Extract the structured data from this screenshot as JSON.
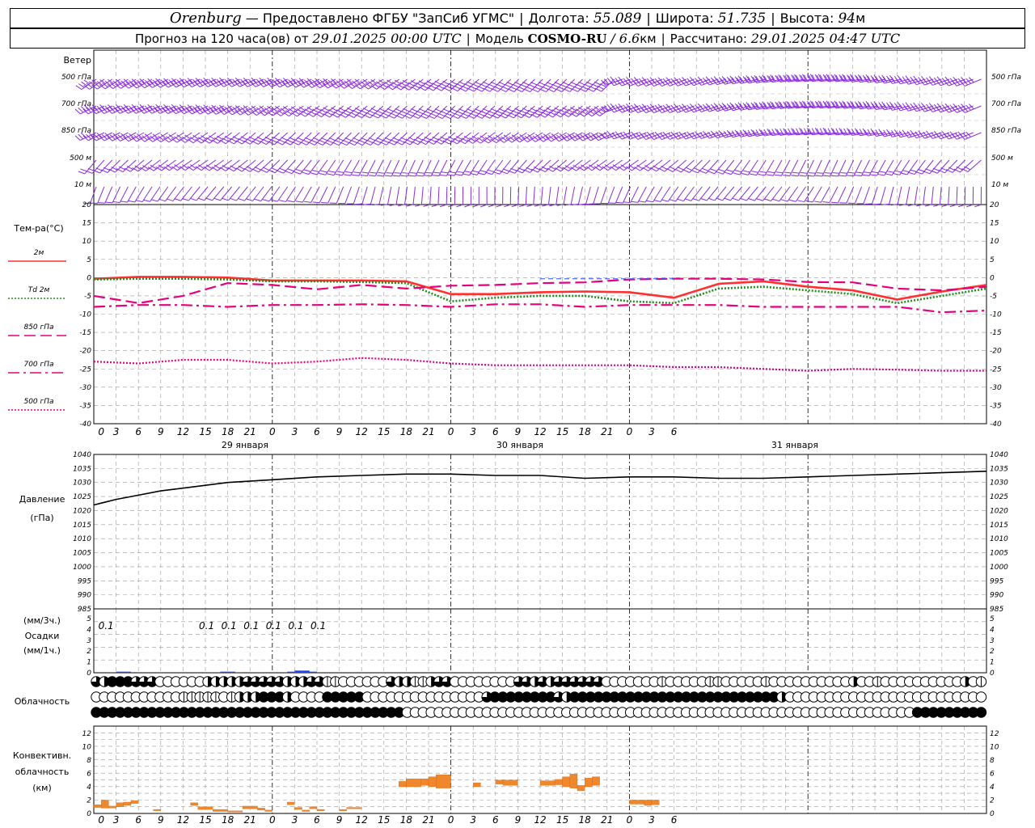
{
  "header": {
    "city": "Orenburg",
    "provider": "— Предоставлено ФГБУ \"ЗапСиб УГМС\"",
    "longitude_label": "Долгота:",
    "longitude_value": "55.089",
    "latitude_label": "Широта:",
    "latitude_value": "51.735",
    "height_label": "Высота:",
    "height_value": "94",
    "height_unit": "м",
    "forecast_label": "Прогноз на 120 часа(ов) от",
    "forecast_start": "29.01.2025 00:00 UTC",
    "model_label": "Модель",
    "model_name": "COSMO-RU",
    "model_res": "/ 6.6",
    "model_res_unit": "км",
    "computed_label": "Рассчитано:",
    "computed_value": "29.01.2025 04:47 UTC"
  },
  "panels": {
    "wind": {
      "title": "Ветер",
      "levels": [
        "500 гПа",
        "700 гПа",
        "850 гПа",
        "500 м",
        "10 м"
      ],
      "color": "#8a2be2"
    },
    "temperature": {
      "title": "Тем-ра(°С)",
      "legend": [
        {
          "label": "2м",
          "color": "#ff3030",
          "style": "solid"
        },
        {
          "label": "Td 2м",
          "color": "#228b22",
          "style": "dotted"
        },
        {
          "label": "850 гПа",
          "color": "#e6007e",
          "style": "dash"
        },
        {
          "label": "700 гПа",
          "color": "#e6007e",
          "style": "dashdot"
        },
        {
          "label": "500 гПа",
          "color": "#e6007e",
          "style": "dotted"
        }
      ],
      "yticks": [
        "20",
        "15",
        "10",
        "5",
        "0",
        "-5",
        "-10",
        "-15",
        "-20",
        "-25",
        "-30",
        "-35",
        "-40"
      ]
    },
    "pressure": {
      "title_1": "Давление",
      "title_2": "(гПа)",
      "yticks": [
        "1040",
        "1035",
        "1030",
        "1025",
        "1020",
        "1015",
        "1010",
        "1005",
        "1000",
        "995",
        "990",
        "985"
      ]
    },
    "precip": {
      "title_1": "(мм/3ч.)",
      "title_2": "Осадки",
      "title_3": "(мм/1ч.)",
      "yticks": [
        "5",
        "4",
        "3",
        "2",
        "1",
        "0"
      ],
      "labels": [
        {
          "hour": 3,
          "text": "0.1"
        },
        {
          "hour": 15,
          "text": "0.1"
        },
        {
          "hour": 18,
          "text": "0.1"
        },
        {
          "hour": 21,
          "text": "0.1"
        },
        {
          "hour": 24,
          "text": "0.1"
        },
        {
          "hour": 27,
          "text": "0.1"
        },
        {
          "hour": 30,
          "text": "0.1"
        }
      ]
    },
    "cloud": {
      "title": "Облачность"
    },
    "convective": {
      "title_1": "Конвективн.",
      "title_2": "облачность",
      "title_3": "(км)",
      "yticks": [
        "12",
        "10",
        "8",
        "6",
        "4",
        "2",
        "0"
      ]
    }
  },
  "x_axis": {
    "tick_labels": [
      "0",
      "3",
      "6",
      "9",
      "12",
      "15",
      "18",
      "21",
      "0",
      "3",
      "6",
      "9",
      "12",
      "15",
      "18",
      "21",
      "0",
      "3",
      "6",
      "9",
      "12",
      "15",
      "18",
      "21",
      "0",
      "3",
      "6"
    ],
    "dates": [
      "29 января",
      "30 января",
      "31 января"
    ]
  },
  "chart_data": [
    {
      "type": "line",
      "title": "Тем-ра(°С)",
      "x_unit": "hours from 29.01.2025 00:00 UTC",
      "ylim": [
        -40,
        20
      ],
      "x": [
        0,
        6,
        12,
        18,
        24,
        30,
        36,
        42,
        48,
        54,
        60,
        66,
        72,
        78,
        84,
        90,
        96,
        102,
        108,
        114,
        120
      ],
      "series": [
        {
          "name": "2м",
          "values": [
            -0.3,
            0.2,
            0.2,
            0,
            -0.8,
            -0.8,
            -0.8,
            -1,
            -4.5,
            -4.5,
            -4,
            -3.8,
            -4,
            -5.5,
            -1.7,
            -1,
            -2.5,
            -3.5,
            -6,
            -3.8,
            -2
          ]
        },
        {
          "name": "Td 2м",
          "values": [
            -0.5,
            -0.3,
            -0.3,
            -0.5,
            -1,
            -1,
            -1.2,
            -1.5,
            -6.5,
            -5.5,
            -5,
            -5,
            -6.5,
            -7,
            -3,
            -2.5,
            -3.5,
            -4.5,
            -7,
            -5,
            -3
          ]
        },
        {
          "name": "850 гПа",
          "values": [
            -5,
            -7,
            -5,
            -1.5,
            -2,
            -3.2,
            -2,
            -3,
            -2.2,
            -2,
            -1.5,
            -1.3,
            -0.5,
            -0.3,
            -0.3,
            -0.5,
            -1.2,
            -1.3,
            -3,
            -3.5,
            -2.5
          ]
        },
        {
          "name": "700 гПа",
          "values": [
            -8,
            -7.5,
            -7.5,
            -8,
            -7.5,
            -7.5,
            -7.3,
            -7.5,
            -8,
            -7.3,
            -7.3,
            -8,
            -7.5,
            -7.5,
            -7.5,
            -8,
            -8,
            -8,
            -8,
            -9.5,
            -9
          ]
        },
        {
          "name": "500 гПа",
          "values": [
            -23,
            -23.5,
            -22.5,
            -22.5,
            -23.5,
            -23,
            -22,
            -22.5,
            -23.5,
            -24,
            -24,
            -24,
            -24,
            -24.5,
            -24.5,
            -25,
            -25.5,
            -25,
            -25.2,
            -25.5,
            -25.5
          ]
        }
      ]
    },
    {
      "type": "line",
      "title": "Давление (гПа)",
      "x_unit": "hours from 29.01.2025 00:00 UTC",
      "ylim": [
        985,
        1040
      ],
      "x": [
        0,
        3,
        6,
        9,
        12,
        18,
        24,
        30,
        36,
        42,
        48,
        54,
        60,
        66,
        72,
        78,
        84,
        90,
        96,
        102,
        108,
        114,
        120
      ],
      "series": [
        {
          "name": "",
          "values": [
            1022,
            1024,
            1025.5,
            1027,
            1028,
            1030,
            1031,
            1032,
            1032.5,
            1033,
            1033,
            1032.5,
            1032.5,
            1031.5,
            1032,
            1032,
            1031.5,
            1031.5,
            1032,
            1032.5,
            1033,
            1033.5,
            1034
          ]
        }
      ]
    },
    {
      "type": "bar",
      "title": "Осадки",
      "x_unit": "hours from 29.01.2025 00:00 UTC",
      "ylim": [
        0,
        5
      ],
      "x": [
        2,
        3,
        4,
        15,
        16,
        17,
        18,
        19,
        21,
        22,
        25,
        26,
        27,
        28,
        29,
        30
      ],
      "values": [
        0.05,
        0.1,
        0.1,
        0.05,
        0.05,
        0.1,
        0.1,
        0.05,
        0.05,
        0.05,
        0.05,
        0.1,
        0.2,
        0.2,
        0.1,
        0.05
      ]
    },
    {
      "type": "table",
      "title": "Облачность",
      "x_unit": "hours from 29.01.2025 00:00 UTC, hourly",
      "x_start": 0,
      "rows": [
        {
          "name": "upper",
          "codes": "3244433300000022222333332223311000000322112330000000033232333333000000010000011000001000000000020010000000000201202"
        },
        {
          "name": "middle",
          "codes": "0000000000011111012224442000044444000000000000000344444444324444444444444444444444444420000000000000000000000000"
        },
        {
          "name": "lower",
          "codes": "4444444444444444444444444444444444444440000000000000000000000000000000000000000000000000000000000000000444444444444"
        }
      ]
    },
    {
      "type": "bar",
      "title": "Конвективн. облачность (км)",
      "x_unit": "hours from 29.01.2025 00:00 UTC",
      "ylim": [
        0,
        13
      ],
      "bars": [
        {
          "x0": 0,
          "x1": 1,
          "bottom": 0.9,
          "top": 1.3
        },
        {
          "x0": 1,
          "x1": 2,
          "bottom": 0.8,
          "top": 2.0
        },
        {
          "x0": 2,
          "x1": 3,
          "bottom": 0.8,
          "top": 1.1
        },
        {
          "x0": 3,
          "x1": 4,
          "bottom": 1.0,
          "top": 1.6
        },
        {
          "x0": 4,
          "x1": 5,
          "bottom": 1.2,
          "top": 1.7
        },
        {
          "x0": 5,
          "x1": 6,
          "bottom": 1.5,
          "top": 1.9
        },
        {
          "x0": 8,
          "x1": 9,
          "bottom": 0.4,
          "top": 0.6
        },
        {
          "x0": 13,
          "x1": 14,
          "bottom": 1.2,
          "top": 1.6
        },
        {
          "x0": 14,
          "x1": 16,
          "bottom": 0.6,
          "top": 1.0
        },
        {
          "x0": 16,
          "x1": 18,
          "bottom": 0.3,
          "top": 0.6
        },
        {
          "x0": 18,
          "x1": 20,
          "bottom": 0.2,
          "top": 0.4
        },
        {
          "x0": 20,
          "x1": 22,
          "bottom": 0.7,
          "top": 1.1
        },
        {
          "x0": 22,
          "x1": 23,
          "bottom": 0.5,
          "top": 0.8
        },
        {
          "x0": 23,
          "x1": 24,
          "bottom": 0.3,
          "top": 0.5
        },
        {
          "x0": 26,
          "x1": 27,
          "bottom": 1.3,
          "top": 1.7
        },
        {
          "x0": 27,
          "x1": 28,
          "bottom": 0.6,
          "top": 0.9
        },
        {
          "x0": 28,
          "x1": 29,
          "bottom": 0.3,
          "top": 0.5
        },
        {
          "x0": 29,
          "x1": 30,
          "bottom": 0.7,
          "top": 1.0
        },
        {
          "x0": 30,
          "x1": 31,
          "bottom": 0.4,
          "top": 0.6
        },
        {
          "x0": 33,
          "x1": 34,
          "bottom": 0.4,
          "top": 0.6
        },
        {
          "x0": 34,
          "x1": 36,
          "bottom": 0.7,
          "top": 0.9
        },
        {
          "x0": 41,
          "x1": 42,
          "bottom": 4.0,
          "top": 4.8
        },
        {
          "x0": 42,
          "x1": 44,
          "bottom": 4.0,
          "top": 5.2
        },
        {
          "x0": 44,
          "x1": 45,
          "bottom": 4.2,
          "top": 5.2
        },
        {
          "x0": 45,
          "x1": 46,
          "bottom": 4.0,
          "top": 5.5
        },
        {
          "x0": 46,
          "x1": 48,
          "bottom": 3.8,
          "top": 5.8
        },
        {
          "x0": 51,
          "x1": 52,
          "bottom": 4.0,
          "top": 4.6
        },
        {
          "x0": 54,
          "x1": 55,
          "bottom": 4.4,
          "top": 5.0
        },
        {
          "x0": 55,
          "x1": 57,
          "bottom": 4.2,
          "top": 5.0
        },
        {
          "x0": 60,
          "x1": 62,
          "bottom": 4.2,
          "top": 4.9
        },
        {
          "x0": 62,
          "x1": 63,
          "bottom": 4.3,
          "top": 5.1
        },
        {
          "x0": 63,
          "x1": 64,
          "bottom": 4.0,
          "top": 5.5
        },
        {
          "x0": 64,
          "x1": 65,
          "bottom": 3.8,
          "top": 5.9
        },
        {
          "x0": 65,
          "x1": 66,
          "bottom": 3.4,
          "top": 4.2
        },
        {
          "x0": 66,
          "x1": 67,
          "bottom": 4.0,
          "top": 5.3
        },
        {
          "x0": 67,
          "x1": 68,
          "bottom": 4.2,
          "top": 5.5
        },
        {
          "x0": 72,
          "x1": 74,
          "bottom": 1.4,
          "top": 2.0
        },
        {
          "x0": 74,
          "x1": 75,
          "bottom": 1.2,
          "top": 2.0
        },
        {
          "x0": 75,
          "x1": 76,
          "bottom": 1.3,
          "top": 2.0
        }
      ]
    }
  ]
}
